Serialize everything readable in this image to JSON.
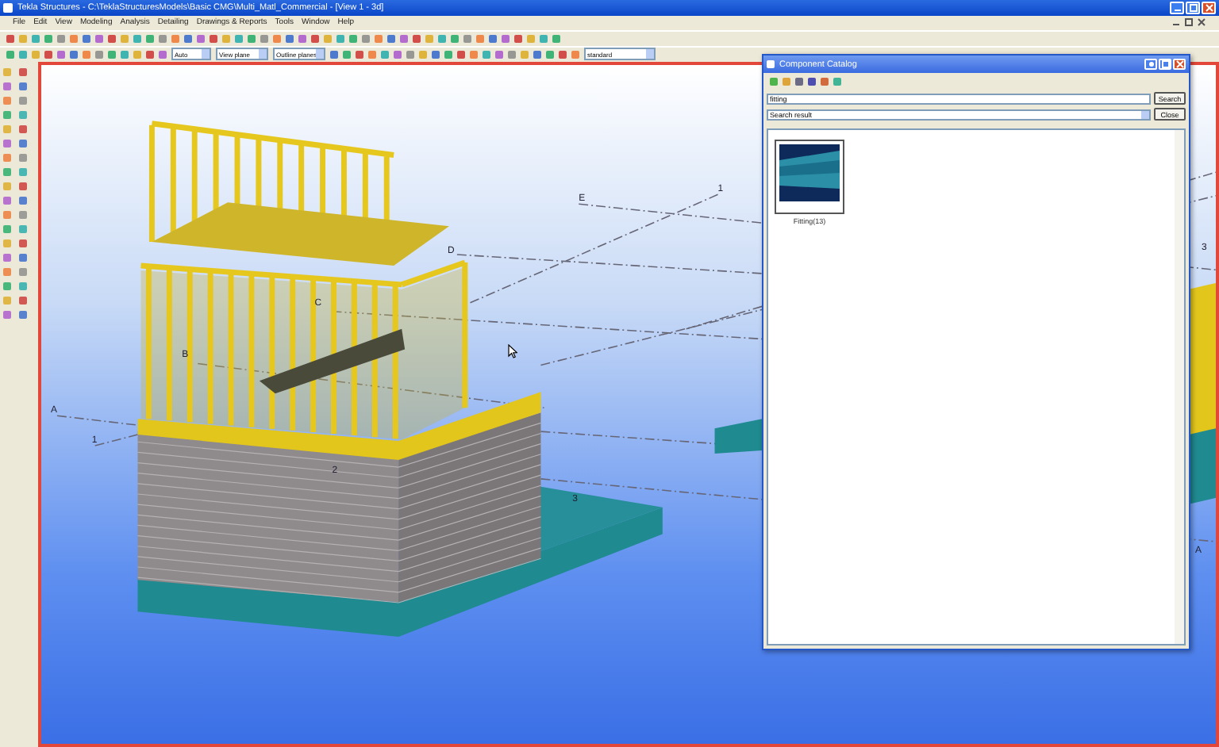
{
  "window": {
    "title": "Tekla Structures - C:\\TeklaStructuresModels\\Basic CMG\\Multi_Matl_Commercial - [View 1 - 3d]"
  },
  "menu": [
    "File",
    "Edit",
    "View",
    "Modeling",
    "Analysis",
    "Detailing",
    "Drawings & Reports",
    "Tools",
    "Window",
    "Help"
  ],
  "toolbar": {
    "view_mode": "Auto",
    "plane": "View plane",
    "planes_display": "Outline planes",
    "filter": "standard"
  },
  "viewport": {
    "grid_labels": [
      "E",
      "1",
      "D",
      "C",
      "B",
      "A",
      "1",
      "2",
      "3",
      "3",
      "A"
    ]
  },
  "catalog": {
    "title": "Component Catalog",
    "search": {
      "value": "fitting"
    },
    "search_button": "Search",
    "group": {
      "value": "Search result"
    },
    "close_button": "Close",
    "items": [
      {
        "label": "Fitting(13)",
        "selected": true
      }
    ]
  }
}
